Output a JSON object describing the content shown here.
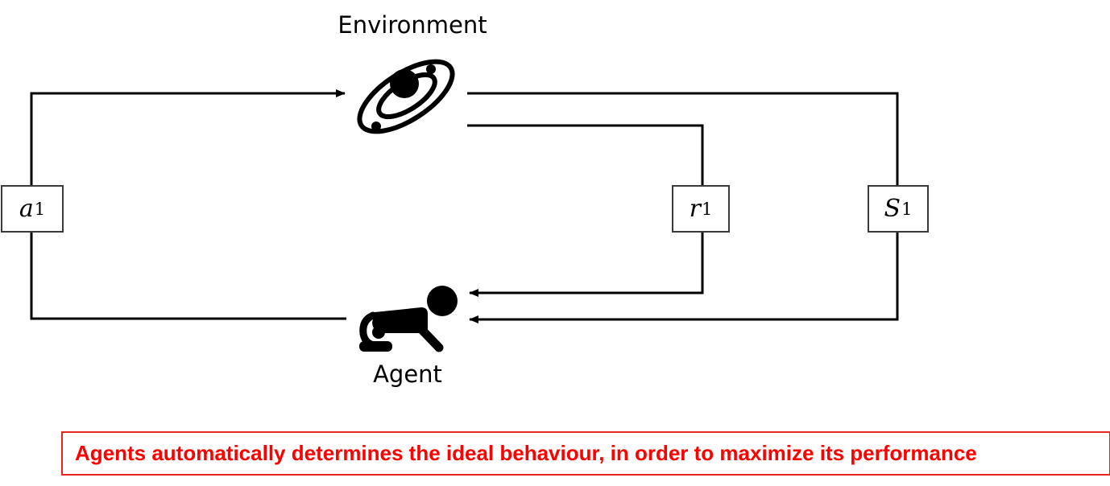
{
  "nodes": {
    "environment": {
      "label": "Environment",
      "icon": "galaxy-icon"
    },
    "agent": {
      "label": "Agent",
      "icon": "crawling-baby-icon"
    }
  },
  "variables": {
    "action": {
      "symbol": "a",
      "subscript": "1"
    },
    "reward": {
      "symbol": "r",
      "subscript": "1"
    },
    "state": {
      "symbol": "S",
      "subscript": "1"
    }
  },
  "caption": "Agents automatically determines the ideal behaviour, in order to maximize its performance",
  "colors": {
    "lines": "#000000",
    "caption_text": "#ff0000",
    "caption_border": "#e8271c"
  }
}
